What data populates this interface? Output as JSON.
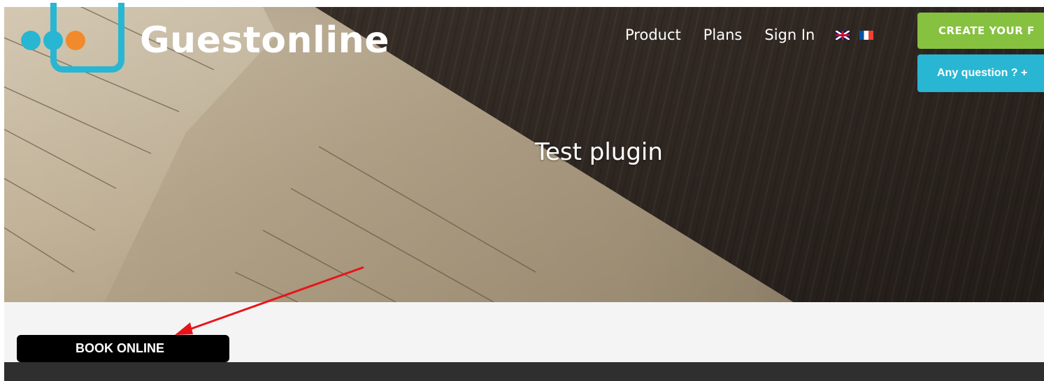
{
  "header": {
    "logo_text": "Guestonline",
    "nav": [
      {
        "label": "Product"
      },
      {
        "label": "Plans"
      },
      {
        "label": "Sign In"
      }
    ],
    "flags": [
      "uk-flag-icon",
      "fr-flag-icon"
    ],
    "create_button_label": "CREATE YOUR F",
    "question_button_label": "Any question ? +"
  },
  "hero": {
    "title": "Test plugin"
  },
  "content": {
    "book_button_label": "BOOK ONLINE"
  },
  "colors": {
    "brand_blue": "#29b6d2",
    "brand_orange": "#f08a2c",
    "create_green": "#86c13f",
    "annotation_red": "#e8141b",
    "book_button_bg": "#000000"
  }
}
